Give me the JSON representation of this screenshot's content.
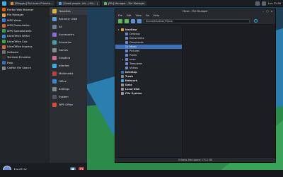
{
  "top_panel": {
    "tasks": [
      {
        "label": "[Blogger] Zip Anzer Primero...",
        "icon_color": "#e8863a"
      },
      {
        "label": "[Good people, nib - (Mi)... ]",
        "icon_color": "#4ea0e6"
      },
      {
        "label": "[Dir] Manager - File Manager",
        "icon_color": "#5cb85c"
      }
    ],
    "right_text": "Lun 21:56"
  },
  "app_menu": {
    "apps": [
      {
        "label": "Firefox Web Browser",
        "icon": "firefox-icon",
        "color": "#e66000"
      },
      {
        "label": "File Manager",
        "icon": "folder-icon",
        "color": "#d9a441"
      },
      {
        "label": "WPS Writer",
        "icon": "wps-writer-icon",
        "color": "#2f7ee0"
      },
      {
        "label": "WPS Presentation",
        "icon": "wps-presentation-icon",
        "color": "#d9622b"
      },
      {
        "label": "WPS Spreadsheets",
        "icon": "wps-spreadsheets-icon",
        "color": "#2da15a"
      },
      {
        "label": "LibreOffice Writer",
        "icon": "lo-writer-icon",
        "color": "#3a86d6"
      },
      {
        "label": "LibreOffice Calc",
        "icon": "lo-calc-icon",
        "color": "#3aa64a"
      },
      {
        "label": "LibreOffice Impress",
        "icon": "lo-impress-icon",
        "color": "#d66a3a"
      },
      {
        "label": "Software",
        "icon": "software-icon",
        "color": "#6f6f6f"
      },
      {
        "label": "Terminal Emulator",
        "icon": "terminal-icon",
        "color": "#333"
      },
      {
        "label": "Help",
        "icon": "help-icon",
        "color": "#3d6fba"
      },
      {
        "label": "Catfish File Search",
        "icon": "catfish-icon",
        "color": "#888"
      }
    ],
    "categories": [
      {
        "label": "Favorites",
        "icon": "star-icon",
        "color": "#e0b33a"
      },
      {
        "label": "Recently Used",
        "icon": "clock-icon",
        "color": "#5e9fd6"
      },
      {
        "label": "All",
        "icon": "all-icon",
        "color": "#6e7f8f"
      },
      {
        "label": "Accessories",
        "icon": "accessories-icon",
        "color": "#8a6ad6"
      },
      {
        "label": "Education",
        "icon": "education-icon",
        "color": "#4aa0a0"
      },
      {
        "label": "Games",
        "icon": "games-icon",
        "color": "#8b8b8b"
      },
      {
        "label": "Graphics",
        "icon": "graphics-icon",
        "color": "#d66a8a"
      },
      {
        "label": "Internet",
        "icon": "internet-icon",
        "color": "#3daee9"
      },
      {
        "label": "Multimedia",
        "icon": "multimedia-icon",
        "color": "#c04040"
      },
      {
        "label": "Office",
        "icon": "office-icon",
        "color": "#3a86d6"
      },
      {
        "label": "Settings",
        "icon": "settings-icon",
        "color": "#7f8c8d"
      },
      {
        "label": "System",
        "icon": "system-icon",
        "color": "#556"
      },
      {
        "label": "WPS Office",
        "icon": "wps-office-icon",
        "color": "#d94a3a"
      }
    ],
    "user": "bautizar",
    "actions": [
      {
        "name": "lock-icon",
        "color": "#3d6fba",
        "glyph": "■"
      },
      {
        "name": "power-icon",
        "color": "#c04040",
        "glyph": "⏻"
      }
    ]
  },
  "file_manager": {
    "title": "Music - File Manager",
    "menu": [
      "File",
      "Edit",
      "View",
      "Go",
      "Help"
    ],
    "path": "/home/bautizar/Music/",
    "tree": [
      {
        "label": "bautizar",
        "indent": 0,
        "bold": true,
        "tri": "▾",
        "color": "#d9a441",
        "selected": false
      },
      {
        "label": "Desktop",
        "indent": 1,
        "bold": false,
        "tri": "",
        "color": "#6a8bd6",
        "selected": false
      },
      {
        "label": "Documents",
        "indent": 1,
        "bold": false,
        "tri": "",
        "color": "#6a8bd6",
        "selected": false
      },
      {
        "label": "Downloads",
        "indent": 1,
        "bold": false,
        "tri": "",
        "color": "#6a8bd6",
        "selected": false
      },
      {
        "label": "Music",
        "indent": 1,
        "bold": false,
        "tri": "",
        "color": "#6a8bd6",
        "selected": true
      },
      {
        "label": "Pictures",
        "indent": 1,
        "bold": false,
        "tri": "",
        "color": "#6a8bd6",
        "selected": false
      },
      {
        "label": "Public",
        "indent": 1,
        "bold": false,
        "tri": "",
        "color": "#6a8bd6",
        "selected": false
      },
      {
        "label": "snap",
        "indent": 1,
        "bold": false,
        "tri": "▸",
        "color": "#6a8bd6",
        "selected": false
      },
      {
        "label": "Templates",
        "indent": 1,
        "bold": false,
        "tri": "",
        "color": "#6a8bd6",
        "selected": false
      },
      {
        "label": "Videos",
        "indent": 1,
        "bold": false,
        "tri": "",
        "color": "#6a8bd6",
        "selected": false
      },
      {
        "label": "Desktop",
        "indent": 0,
        "bold": true,
        "tri": "",
        "color": "#3d6fba",
        "selected": false
      },
      {
        "label": "Trash",
        "indent": 0,
        "bold": true,
        "tri": "",
        "color": "#7f8c8d",
        "selected": false
      },
      {
        "label": "Network",
        "indent": 0,
        "bold": true,
        "tri": "",
        "color": "#3daee9",
        "selected": false
      },
      {
        "label": "Data",
        "indent": 0,
        "bold": true,
        "tri": "",
        "color": "#9a9a9a",
        "selected": false
      },
      {
        "label": "Local Disk",
        "indent": 0,
        "bold": true,
        "tri": "",
        "color": "#9a9a9a",
        "selected": false
      },
      {
        "label": "File System",
        "indent": 0,
        "bold": true,
        "tri": "",
        "color": "#9a9a9a",
        "selected": false
      }
    ],
    "status": "0 items, free space: 171.2 GB"
  }
}
